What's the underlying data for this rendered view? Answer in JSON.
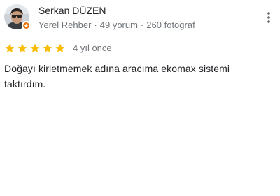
{
  "reviewer": {
    "name": "Serkan DÜZEN",
    "level": "Yerel Rehber",
    "reviews": "49 yorum",
    "photos": "260 fotoğraf",
    "separator": "·",
    "avatar_icon": "user-photo-icon",
    "badge_icon": "local-guide-badge-icon",
    "badge_color": "#e8710a"
  },
  "menu": {
    "icon": "more-vertical-icon"
  },
  "review": {
    "rating": 5,
    "rating_max": 5,
    "star_color": "#fbbc04",
    "date": "4 yıl önce",
    "text": "Doğayı kirletmemek adına aracıma ekomax sistemi taktırdım."
  }
}
